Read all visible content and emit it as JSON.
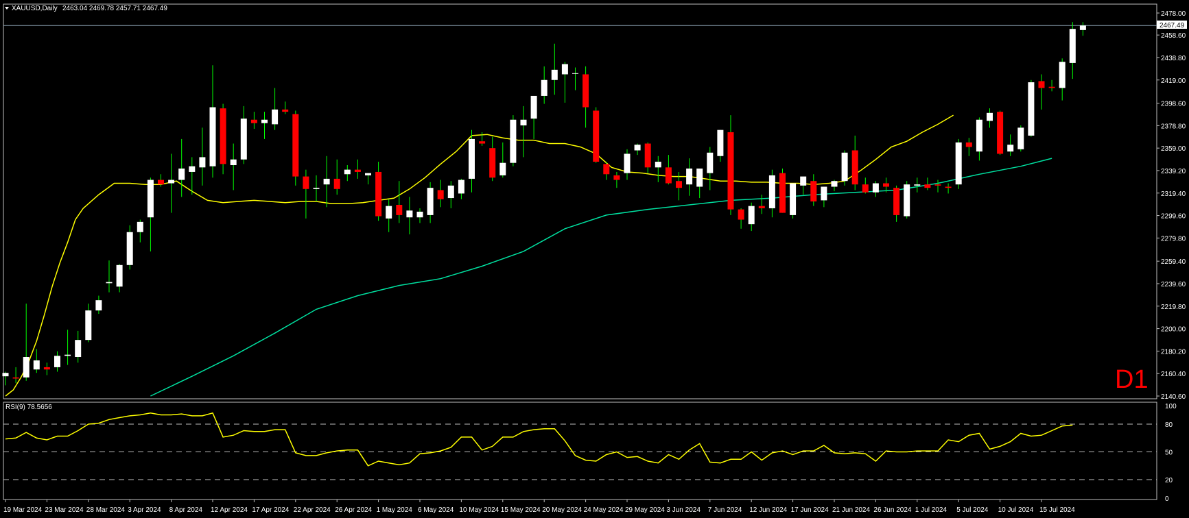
{
  "header": {
    "symbol_title": "XAUUSD,Daily",
    "ohlc": "2463.04 2469.78 2457.71 2467.49"
  },
  "rsi_label": "RSI(9) 78.5656",
  "timeframe_label": "D1",
  "current_price_label": "2467.49",
  "colors": {
    "background": "#000000",
    "bear": "#ff0000",
    "bull": "#ffffff",
    "wick": "#00ff00",
    "ma_fast": "#ffff00",
    "ma_slow": "#00e0a0",
    "rsi": "#ffff00",
    "grid": "#ffffff"
  },
  "chart_data": [
    {
      "type": "candlestick",
      "title": "XAUUSD,Daily",
      "ylim": [
        2140.6,
        2478.0
      ],
      "y_ticks": [
        2478.0,
        2458.6,
        2438.8,
        2419.0,
        2398.6,
        2378.8,
        2359.0,
        2339.2,
        2319.4,
        2299.6,
        2279.8,
        2259.4,
        2239.6,
        2219.8,
        2200.0,
        2180.2,
        2160.4,
        2140.6
      ],
      "y_tick_labels": [
        "2478.00",
        "2458.60",
        "2438.80",
        "2419.00",
        "2398.60",
        "2378.80",
        "2359.00",
        "2339.20",
        "2319.40",
        "2299.60",
        "2279.80",
        "2259.40",
        "2239.60",
        "2219.80",
        "2200.00",
        "2180.20",
        "2160.40",
        "2140.60"
      ],
      "x_labels": [
        {
          "i": 0,
          "text": "19 Mar 2024"
        },
        {
          "i": 4,
          "text": "23 Mar 2024"
        },
        {
          "i": 8,
          "text": "28 Mar 2024"
        },
        {
          "i": 12,
          "text": "3 Apr 2024"
        },
        {
          "i": 16,
          "text": "8 Apr 2024"
        },
        {
          "i": 20,
          "text": "12 Apr 2024"
        },
        {
          "i": 24,
          "text": "17 Apr 2024"
        },
        {
          "i": 28,
          "text": "22 Apr 2024"
        },
        {
          "i": 32,
          "text": "26 Apr 2024"
        },
        {
          "i": 36,
          "text": "1 May 2024"
        },
        {
          "i": 40,
          "text": "6 May 2024"
        },
        {
          "i": 44,
          "text": "10 May 2024"
        },
        {
          "i": 48,
          "text": "15 May 2024"
        },
        {
          "i": 52,
          "text": "20 May 2024"
        },
        {
          "i": 56,
          "text": "24 May 2024"
        },
        {
          "i": 60,
          "text": "29 May 2024"
        },
        {
          "i": 64,
          "text": "3 Jun 2024"
        },
        {
          "i": 68,
          "text": "7 Jun 2024"
        },
        {
          "i": 72,
          "text": "12 Jun 2024"
        },
        {
          "i": 76,
          "text": "17 Jun 2024"
        },
        {
          "i": 80,
          "text": "21 Jun 2024"
        },
        {
          "i": 84,
          "text": "26 Jun 2024"
        },
        {
          "i": 88,
          "text": "1 Jul 2024"
        },
        {
          "i": 92,
          "text": "5 Jul 2024"
        },
        {
          "i": 96,
          "text": "10 Jul 2024"
        },
        {
          "i": 100,
          "text": "15 Jul 2024"
        }
      ],
      "candles": [
        {
          "o": 2158,
          "h": 2162,
          "l": 2150,
          "c": 2161
        },
        {
          "o": 2157,
          "h": 2166,
          "l": 2152,
          "c": 2156
        },
        {
          "o": 2157,
          "h": 2222,
          "l": 2154,
          "c": 2175
        },
        {
          "o": 2164,
          "h": 2182,
          "l": 2161,
          "c": 2172
        },
        {
          "o": 2166,
          "h": 2170,
          "l": 2159,
          "c": 2164
        },
        {
          "o": 2166,
          "h": 2180,
          "l": 2162,
          "c": 2176
        },
        {
          "o": 2176,
          "h": 2199,
          "l": 2168,
          "c": 2177
        },
        {
          "o": 2175,
          "h": 2198,
          "l": 2170,
          "c": 2190
        },
        {
          "o": 2190,
          "h": 2222,
          "l": 2188,
          "c": 2216
        },
        {
          "o": 2216,
          "h": 2229,
          "l": 2213,
          "c": 2225
        },
        {
          "o": 2240,
          "h": 2260,
          "l": 2232,
          "c": 2241
        },
        {
          "o": 2237,
          "h": 2257,
          "l": 2232,
          "c": 2256
        },
        {
          "o": 2256,
          "h": 2291,
          "l": 2252,
          "c": 2285
        },
        {
          "o": 2285,
          "h": 2296,
          "l": 2276,
          "c": 2294
        },
        {
          "o": 2298,
          "h": 2333,
          "l": 2268,
          "c": 2331
        },
        {
          "o": 2331,
          "h": 2336,
          "l": 2325,
          "c": 2327
        },
        {
          "o": 2328,
          "h": 2354,
          "l": 2302,
          "c": 2331
        },
        {
          "o": 2331,
          "h": 2367,
          "l": 2316,
          "c": 2341
        },
        {
          "o": 2338,
          "h": 2351,
          "l": 2318,
          "c": 2343
        },
        {
          "o": 2342,
          "h": 2377,
          "l": 2326,
          "c": 2351
        },
        {
          "o": 2343,
          "h": 2432,
          "l": 2333,
          "c": 2395
        },
        {
          "o": 2394,
          "h": 2398,
          "l": 2336,
          "c": 2345
        },
        {
          "o": 2344,
          "h": 2363,
          "l": 2322,
          "c": 2349
        },
        {
          "o": 2349,
          "h": 2396,
          "l": 2345,
          "c": 2385
        },
        {
          "o": 2384,
          "h": 2391,
          "l": 2376,
          "c": 2381
        },
        {
          "o": 2381,
          "h": 2391,
          "l": 2367,
          "c": 2384
        },
        {
          "o": 2380,
          "h": 2412,
          "l": 2375,
          "c": 2393
        },
        {
          "o": 2393,
          "h": 2400,
          "l": 2389,
          "c": 2391
        },
        {
          "o": 2389,
          "h": 2392,
          "l": 2326,
          "c": 2334
        },
        {
          "o": 2334,
          "h": 2340,
          "l": 2297,
          "c": 2323
        },
        {
          "o": 2323,
          "h": 2335,
          "l": 2312,
          "c": 2324
        },
        {
          "o": 2327,
          "h": 2352,
          "l": 2307,
          "c": 2332
        },
        {
          "o": 2332,
          "h": 2349,
          "l": 2318,
          "c": 2323
        },
        {
          "o": 2336,
          "h": 2344,
          "l": 2330,
          "c": 2340
        },
        {
          "o": 2340,
          "h": 2349,
          "l": 2332,
          "c": 2338
        },
        {
          "o": 2335,
          "h": 2337,
          "l": 2327,
          "c": 2337
        },
        {
          "o": 2338,
          "h": 2347,
          "l": 2295,
          "c": 2299
        },
        {
          "o": 2297,
          "h": 2314,
          "l": 2285,
          "c": 2308
        },
        {
          "o": 2309,
          "h": 2330,
          "l": 2293,
          "c": 2300
        },
        {
          "o": 2298,
          "h": 2316,
          "l": 2283,
          "c": 2304
        },
        {
          "o": 2298,
          "h": 2306,
          "l": 2293,
          "c": 2303
        },
        {
          "o": 2300,
          "h": 2329,
          "l": 2293,
          "c": 2324
        },
        {
          "o": 2322,
          "h": 2331,
          "l": 2307,
          "c": 2314
        },
        {
          "o": 2315,
          "h": 2330,
          "l": 2306,
          "c": 2326
        },
        {
          "o": 2319,
          "h": 2332,
          "l": 2314,
          "c": 2331
        },
        {
          "o": 2332,
          "h": 2375,
          "l": 2320,
          "c": 2367
        },
        {
          "o": 2365,
          "h": 2373,
          "l": 2361,
          "c": 2363
        },
        {
          "o": 2359,
          "h": 2369,
          "l": 2330,
          "c": 2333
        },
        {
          "o": 2335,
          "h": 2364,
          "l": 2333,
          "c": 2346
        },
        {
          "o": 2346,
          "h": 2388,
          "l": 2343,
          "c": 2384
        },
        {
          "o": 2379,
          "h": 2396,
          "l": 2351,
          "c": 2384
        },
        {
          "o": 2385,
          "h": 2395,
          "l": 2367,
          "c": 2405
        },
        {
          "o": 2405,
          "h": 2431,
          "l": 2398,
          "c": 2419
        },
        {
          "o": 2419,
          "h": 2451,
          "l": 2406,
          "c": 2428
        },
        {
          "o": 2424,
          "h": 2435,
          "l": 2399,
          "c": 2433
        },
        {
          "o": 2425,
          "h": 2430,
          "l": 2410,
          "c": 2425
        },
        {
          "o": 2424,
          "h": 2431,
          "l": 2377,
          "c": 2395
        },
        {
          "o": 2392,
          "h": 2395,
          "l": 2346,
          "c": 2347
        },
        {
          "o": 2345,
          "h": 2347,
          "l": 2331,
          "c": 2336
        },
        {
          "o": 2335,
          "h": 2338,
          "l": 2324,
          "c": 2331
        },
        {
          "o": 2337,
          "h": 2358,
          "l": 2331,
          "c": 2354
        },
        {
          "o": 2357,
          "h": 2363,
          "l": 2353,
          "c": 2362
        },
        {
          "o": 2363,
          "h": 2364,
          "l": 2337,
          "c": 2342
        },
        {
          "o": 2342,
          "h": 2352,
          "l": 2329,
          "c": 2347
        },
        {
          "o": 2342,
          "h": 2353,
          "l": 2327,
          "c": 2328
        },
        {
          "o": 2330,
          "h": 2338,
          "l": 2313,
          "c": 2324
        },
        {
          "o": 2327,
          "h": 2350,
          "l": 2317,
          "c": 2341
        },
        {
          "o": 2325,
          "h": 2341,
          "l": 2315,
          "c": 2341
        },
        {
          "o": 2337,
          "h": 2360,
          "l": 2322,
          "c": 2355
        },
        {
          "o": 2352,
          "h": 2375,
          "l": 2347,
          "c": 2375
        },
        {
          "o": 2373,
          "h": 2388,
          "l": 2300,
          "c": 2305
        },
        {
          "o": 2305,
          "h": 2306,
          "l": 2288,
          "c": 2296
        },
        {
          "o": 2292,
          "h": 2311,
          "l": 2286,
          "c": 2308
        },
        {
          "o": 2308,
          "h": 2318,
          "l": 2301,
          "c": 2306
        },
        {
          "o": 2306,
          "h": 2340,
          "l": 2298,
          "c": 2335
        },
        {
          "o": 2337,
          "h": 2341,
          "l": 2302,
          "c": 2302
        },
        {
          "o": 2300,
          "h": 2327,
          "l": 2297,
          "c": 2328
        },
        {
          "o": 2326,
          "h": 2333,
          "l": 2318,
          "c": 2334
        },
        {
          "o": 2330,
          "h": 2336,
          "l": 2308,
          "c": 2312
        },
        {
          "o": 2313,
          "h": 2325,
          "l": 2307,
          "c": 2325
        },
        {
          "o": 2325,
          "h": 2331,
          "l": 2321,
          "c": 2330
        },
        {
          "o": 2330,
          "h": 2357,
          "l": 2326,
          "c": 2355
        },
        {
          "o": 2357,
          "h": 2370,
          "l": 2322,
          "c": 2327
        },
        {
          "o": 2327,
          "h": 2333,
          "l": 2319,
          "c": 2320
        },
        {
          "o": 2320,
          "h": 2330,
          "l": 2316,
          "c": 2328
        },
        {
          "o": 2328,
          "h": 2333,
          "l": 2320,
          "c": 2325
        },
        {
          "o": 2324,
          "h": 2326,
          "l": 2294,
          "c": 2300
        },
        {
          "o": 2299,
          "h": 2330,
          "l": 2297,
          "c": 2327
        },
        {
          "o": 2326,
          "h": 2333,
          "l": 2320,
          "c": 2327
        },
        {
          "o": 2327,
          "h": 2333,
          "l": 2322,
          "c": 2324
        },
        {
          "o": 2327,
          "h": 2331,
          "l": 2320,
          "c": 2326
        },
        {
          "o": 2325,
          "h": 2328,
          "l": 2319,
          "c": 2324
        },
        {
          "o": 2327,
          "h": 2367,
          "l": 2323,
          "c": 2364
        },
        {
          "o": 2364,
          "h": 2368,
          "l": 2352,
          "c": 2360
        },
        {
          "o": 2356,
          "h": 2386,
          "l": 2348,
          "c": 2384
        },
        {
          "o": 2383,
          "h": 2394,
          "l": 2377,
          "c": 2390
        },
        {
          "o": 2391,
          "h": 2392,
          "l": 2353,
          "c": 2354
        },
        {
          "o": 2356,
          "h": 2371,
          "l": 2352,
          "c": 2362
        },
        {
          "o": 2358,
          "h": 2379,
          "l": 2356,
          "c": 2377
        },
        {
          "o": 2370,
          "h": 2419,
          "l": 2369,
          "c": 2417
        },
        {
          "o": 2418,
          "h": 2424,
          "l": 2393,
          "c": 2412
        },
        {
          "o": 2413,
          "h": 2419,
          "l": 2409,
          "c": 2412
        },
        {
          "o": 2412,
          "h": 2438,
          "l": 2401,
          "c": 2435
        },
        {
          "o": 2434,
          "h": 2470,
          "l": 2420,
          "c": 2464
        },
        {
          "o": 2463,
          "h": 2470,
          "l": 2458,
          "c": 2467
        }
      ],
      "ma_fast": [
        [
          0,
          2140.6
        ],
        [
          6,
          2146
        ],
        [
          12,
          2157
        ],
        [
          18,
          2171
        ],
        [
          24,
          2189
        ],
        [
          30,
          2212
        ],
        [
          36,
          2237
        ],
        [
          42,
          2258
        ],
        [
          48,
          2276
        ],
        [
          54,
          2296
        ],
        [
          60,
          2306
        ],
        [
          72,
          2318
        ],
        [
          84,
          2328
        ],
        [
          96,
          2328
        ],
        [
          108,
          2327
        ],
        [
          120,
          2327
        ],
        [
          132,
          2330
        ],
        [
          144,
          2321
        ],
        [
          156,
          2313
        ],
        [
          168,
          2311
        ],
        [
          180,
          2312
        ],
        [
          192,
          2313
        ],
        [
          204,
          2312
        ],
        [
          216,
          2311
        ],
        [
          228,
          2312
        ],
        [
          240,
          2312
        ],
        [
          252,
          2310
        ],
        [
          264,
          2310
        ],
        [
          276,
          2311
        ],
        [
          288,
          2313
        ],
        [
          300,
          2315
        ],
        [
          312,
          2323
        ],
        [
          324,
          2333
        ],
        [
          336,
          2345
        ],
        [
          348,
          2356
        ],
        [
          360,
          2370
        ],
        [
          372,
          2371
        ],
        [
          384,
          2368
        ],
        [
          396,
          2366
        ],
        [
          408,
          2366
        ],
        [
          420,
          2363
        ],
        [
          432,
          2363
        ],
        [
          444,
          2360
        ],
        [
          456,
          2354
        ],
        [
          468,
          2342
        ],
        [
          480,
          2338
        ],
        [
          492,
          2337
        ],
        [
          504,
          2335
        ],
        [
          516,
          2334
        ],
        [
          528,
          2334
        ],
        [
          540,
          2332
        ],
        [
          552,
          2330
        ],
        [
          564,
          2330
        ],
        [
          576,
          2329
        ],
        [
          588,
          2329
        ],
        [
          600,
          2328
        ],
        [
          612,
          2328
        ],
        [
          624,
          2327
        ],
        [
          636,
          2328
        ],
        [
          648,
          2330
        ],
        [
          660,
          2339
        ],
        [
          672,
          2349
        ],
        [
          684,
          2360
        ],
        [
          696,
          2365
        ],
        [
          708,
          2373
        ],
        [
          720,
          2380
        ],
        [
          732,
          2388
        ]
      ],
      "ma_fast_x_offset_note": "",
      "rsi": {
        "label": "RSI(9) 78.5656",
        "ylim": [
          0,
          100
        ],
        "levels": [
          20,
          50,
          80
        ],
        "y_tick_labels": [
          "100",
          "80",
          "50",
          "20",
          "0"
        ],
        "values": [
          64,
          65,
          71,
          65,
          63,
          67,
          67,
          73,
          80,
          81,
          85,
          87,
          89,
          90,
          92,
          90,
          90,
          91,
          89,
          89,
          92,
          66,
          68,
          73,
          72,
          72,
          74,
          74,
          49,
          46,
          46,
          49,
          51,
          52,
          52,
          35,
          40,
          38,
          36,
          38,
          48,
          49,
          51,
          55,
          66,
          66,
          52,
          56,
          66,
          66,
          72,
          74,
          75,
          75,
          62,
          46,
          41,
          40,
          47,
          50,
          44,
          45,
          40,
          38,
          47,
          42,
          52,
          59,
          39,
          38,
          42,
          42,
          50,
          41,
          49,
          51,
          47,
          51,
          51,
          57,
          49,
          48,
          49,
          48,
          40,
          51,
          50,
          50,
          51,
          51,
          51,
          63,
          61,
          68,
          70,
          53,
          56,
          61,
          70,
          67,
          68,
          73,
          78,
          79
        ]
      }
    }
  ]
}
